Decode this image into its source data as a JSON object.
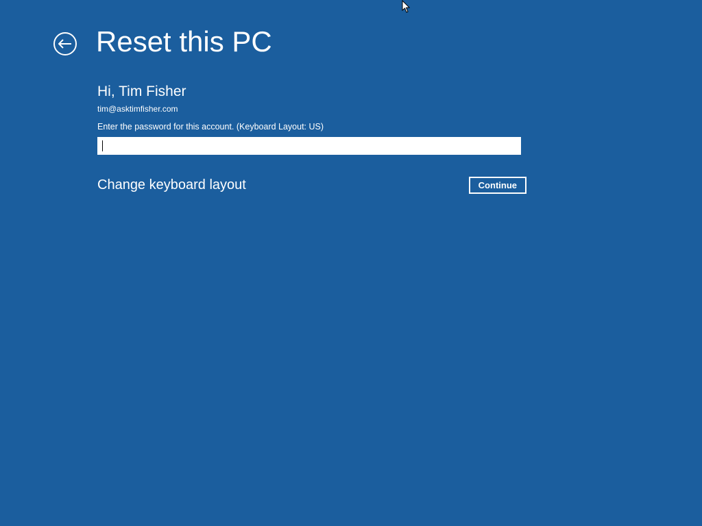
{
  "header": {
    "title": "Reset this PC"
  },
  "account": {
    "greeting": "Hi, Tim Fisher",
    "email": "tim@asktimfisher.com",
    "prompt": "Enter the password for this account. (Keyboard Layout: US)",
    "password_value": ""
  },
  "actions": {
    "change_layout": "Change keyboard layout",
    "continue": "Continue"
  }
}
